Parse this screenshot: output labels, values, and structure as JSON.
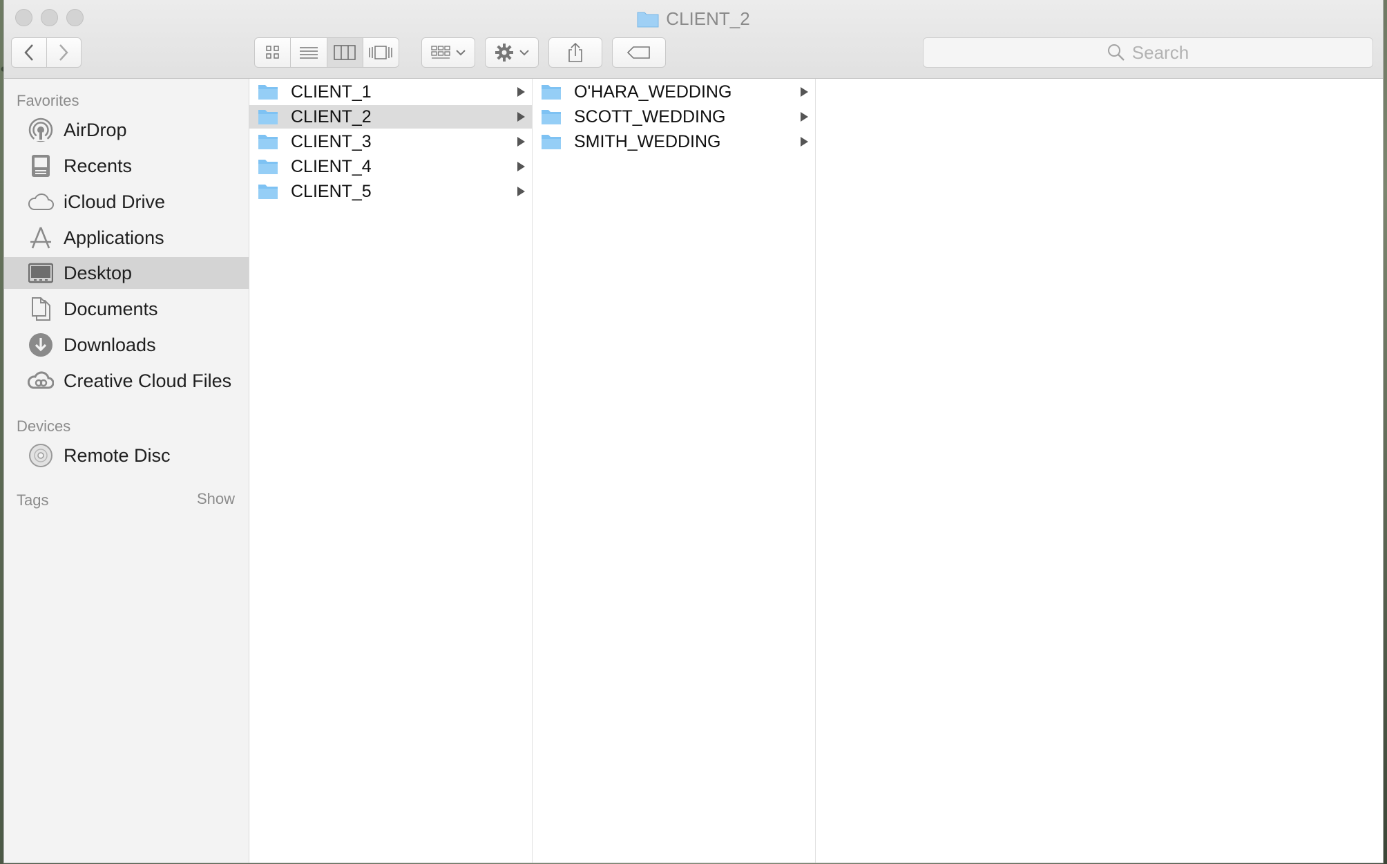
{
  "window": {
    "title": "CLIENT_2"
  },
  "toolbar": {
    "search_placeholder": "Search"
  },
  "sidebar": {
    "favorites_heading": "Favorites",
    "favorites": [
      {
        "label": "AirDrop",
        "icon": "airdrop-icon"
      },
      {
        "label": "Recents",
        "icon": "recents-icon"
      },
      {
        "label": "iCloud Drive",
        "icon": "cloud-icon"
      },
      {
        "label": "Applications",
        "icon": "applications-icon"
      },
      {
        "label": "Desktop",
        "icon": "desktop-icon",
        "selected": true
      },
      {
        "label": "Documents",
        "icon": "documents-icon"
      },
      {
        "label": "Downloads",
        "icon": "downloads-icon"
      },
      {
        "label": "Creative Cloud Files",
        "icon": "creative-cloud-icon"
      }
    ],
    "devices_heading": "Devices",
    "devices": [
      {
        "label": "Remote Disc",
        "icon": "disc-icon"
      }
    ],
    "tags_heading": "Tags",
    "tags_show": "Show"
  },
  "columns": [
    {
      "items": [
        {
          "name": "CLIENT_1"
        },
        {
          "name": "CLIENT_2",
          "selected": true
        },
        {
          "name": "CLIENT_3"
        },
        {
          "name": "CLIENT_4"
        },
        {
          "name": "CLIENT_5"
        }
      ]
    },
    {
      "items": [
        {
          "name": "O'HARA_WEDDING"
        },
        {
          "name": "SCOTT_WEDDING"
        },
        {
          "name": "SMITH_WEDDING"
        }
      ]
    }
  ],
  "colors": {
    "folder": "#7ec2f3",
    "folder_tab": "#6ab3ea",
    "selection": "#dcdcdc",
    "sidebar_selection": "#d4d4d4"
  }
}
